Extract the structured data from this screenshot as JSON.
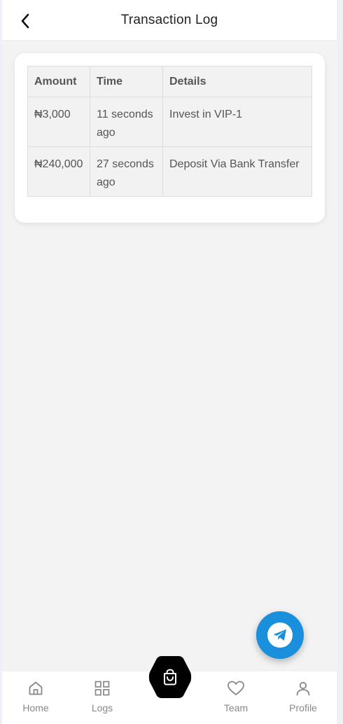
{
  "header": {
    "title": "Transaction Log",
    "back_icon": "chevron-left-icon"
  },
  "table": {
    "columns": [
      "Amount",
      "Time",
      "Details"
    ],
    "rows": [
      {
        "amount": "₦3,000",
        "time": "11 seconds ago",
        "details": "Invest in VIP-1"
      },
      {
        "amount": "₦240,000",
        "time": "27 seconds ago",
        "details": "Deposit Via Bank Transfer"
      }
    ]
  },
  "fab": {
    "icon": "telegram-icon",
    "color": "#1a8fdc"
  },
  "nav": {
    "items": [
      {
        "label": "Home",
        "icon": "home-icon"
      },
      {
        "label": "Logs",
        "icon": "grid-icon"
      },
      {
        "label": "Team",
        "icon": "heart-icon"
      },
      {
        "label": "Profile",
        "icon": "user-icon"
      }
    ],
    "center_icon": "shopping-bag-icon"
  }
}
